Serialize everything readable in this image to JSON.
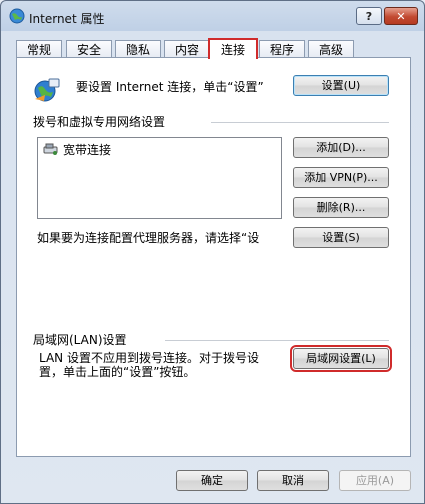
{
  "window": {
    "title": "Internet 属性"
  },
  "titlebar_buttons": {
    "help": "?",
    "close": "✕"
  },
  "tabs": [
    "常规",
    "安全",
    "隐私",
    "内容",
    "连接",
    "程序",
    "高级"
  ],
  "active_tab": "连接",
  "setup": {
    "text": "要设置 Internet 连接，单击“设置”",
    "button": "设置(U)"
  },
  "dialup": {
    "heading": "拨号和虚拟专用网络设置",
    "items": [
      "宽带连接"
    ],
    "add_button": "添加(D)...",
    "add_vpn_button": "添加 VPN(P)...",
    "remove_button": "删除(R)...",
    "proxy_text": "如果要为连接配置代理服务器，请选择“设",
    "settings_button": "设置(S)"
  },
  "lan": {
    "heading": "局域网(LAN)设置",
    "text_line1": "LAN 设置不应用到拨号连接。对于拨号设",
    "text_line2": "置，单击上面的“设置”按钮。",
    "button": "局域网设置(L)"
  },
  "footer": {
    "ok": "确定",
    "cancel": "取消",
    "apply": "应用(A)"
  }
}
